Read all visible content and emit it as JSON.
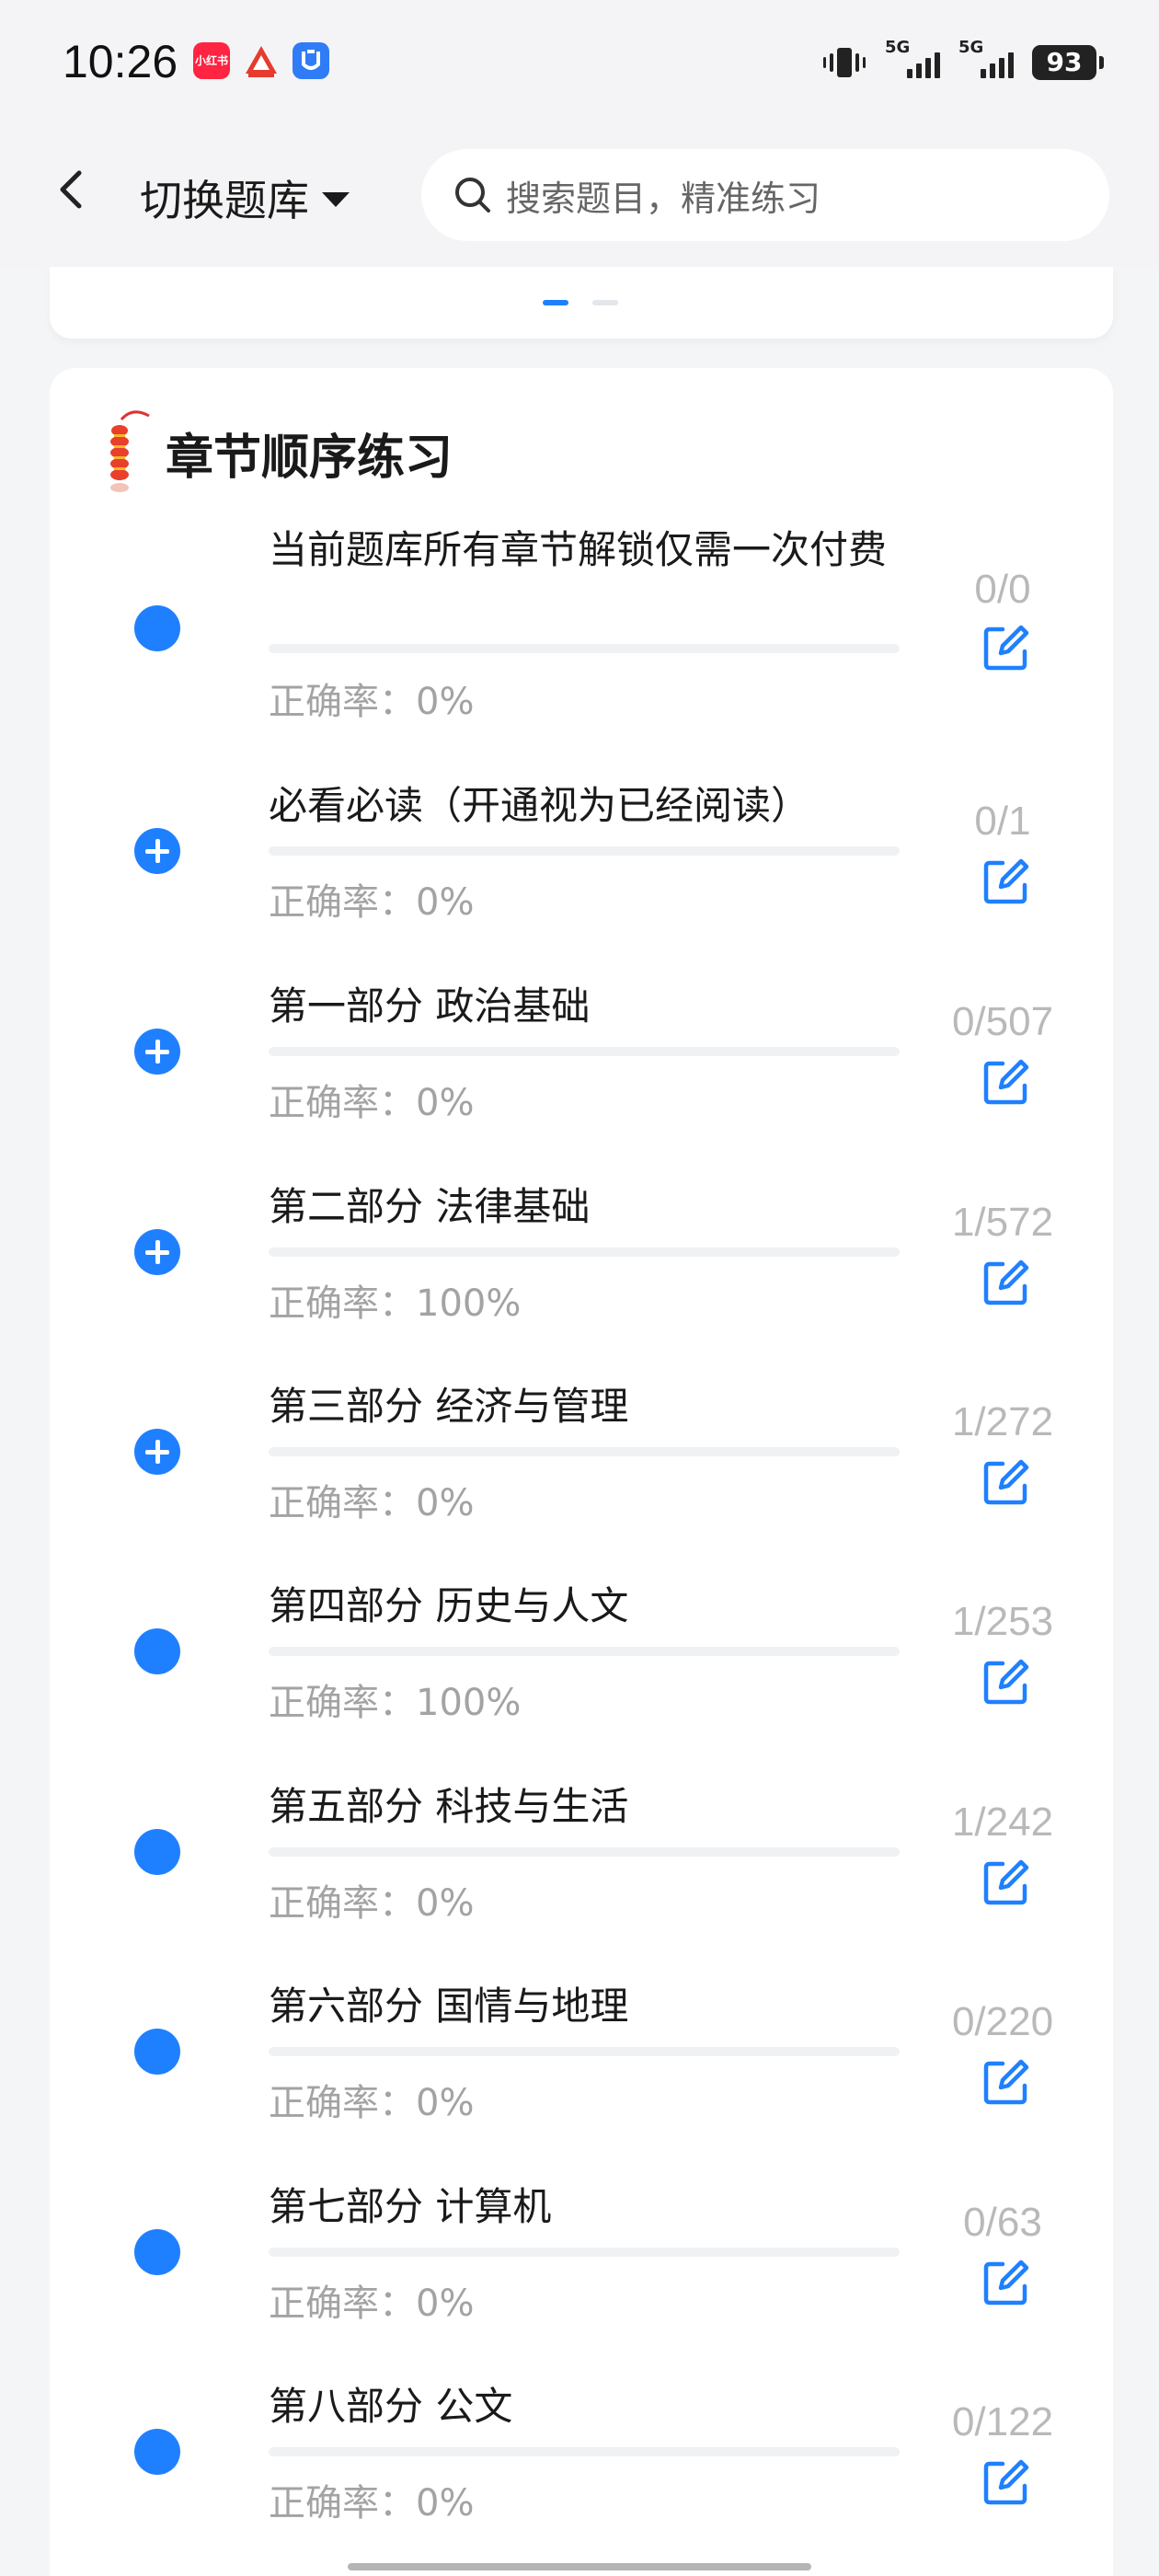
{
  "status_bar": {
    "time": "10:26",
    "app_icons": [
      "xiaohongshu-icon",
      "red-triangle-app-icon",
      "blue-shield-app-icon"
    ],
    "app_icon_labels": [
      "小红书"
    ],
    "network": [
      "5G",
      "5G"
    ],
    "battery": "93"
  },
  "header": {
    "switch_bank_label": "切换题库",
    "search_placeholder": "搜索题目，精准练习"
  },
  "carousel": {
    "page_count": 2,
    "active_index": 0
  },
  "section": {
    "title": "章节顺序练习",
    "accent_color": "#1f80ff",
    "chapters": [
      {
        "title": "当前题库所有章节解锁仅需一次付费",
        "accuracy": "正确率：0%",
        "count": "0/0",
        "expandable": false,
        "progress": 0
      },
      {
        "title": "必看必读（开通视为已经阅读）",
        "accuracy": "正确率：0%",
        "count": "0/1",
        "expandable": true,
        "progress": 0
      },
      {
        "title": "第一部分 政治基础",
        "accuracy": "正确率：0%",
        "count": "0/507",
        "expandable": true,
        "progress": 0
      },
      {
        "title": "第二部分 法律基础",
        "accuracy": "正确率：100%",
        "count": "1/572",
        "expandable": true,
        "progress": 0
      },
      {
        "title": "第三部分 经济与管理",
        "accuracy": "正确率：0%",
        "count": "1/272",
        "expandable": true,
        "progress": 0
      },
      {
        "title": "第四部分 历史与人文",
        "accuracy": "正确率：100%",
        "count": "1/253",
        "expandable": false,
        "progress": 0
      },
      {
        "title": "第五部分 科技与生活",
        "accuracy": "正确率：0%",
        "count": "1/242",
        "expandable": false,
        "progress": 0
      },
      {
        "title": "第六部分 国情与地理",
        "accuracy": "正确率：0%",
        "count": "0/220",
        "expandable": false,
        "progress": 0
      },
      {
        "title": "第七部分 计算机",
        "accuracy": "正确率：0%",
        "count": "0/63",
        "expandable": false,
        "progress": 0
      },
      {
        "title": "第八部分 公文",
        "accuracy": "正确率：0%",
        "count": "0/122",
        "expandable": false,
        "progress": 0
      }
    ]
  }
}
